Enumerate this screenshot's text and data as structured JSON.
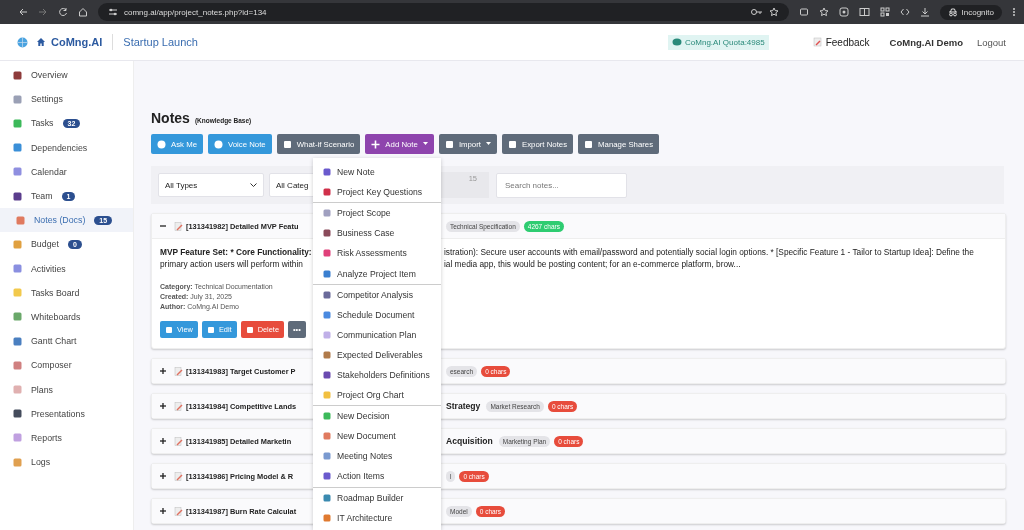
{
  "browser": {
    "url": "comng.ai/app/project_notes.php?id=134",
    "mode": "Incognito"
  },
  "header": {
    "brand": "CoMng.AI",
    "project": "Startup Launch",
    "quota": "CoMng.AI Quota:4985",
    "feedback": "Feedback",
    "user": "CoMng.AI Demo",
    "logout": "Logout"
  },
  "sidebar": {
    "items": [
      {
        "label": "Overview",
        "selected": false
      },
      {
        "label": "Settings",
        "selected": false
      },
      {
        "label": "Tasks",
        "badge": "32",
        "selected": false
      },
      {
        "label": "Dependencies",
        "selected": false
      },
      {
        "label": "Calendar",
        "selected": false
      },
      {
        "label": "Team",
        "badge": "1",
        "selected": false
      },
      {
        "label": "Notes (Docs)",
        "badge": "15",
        "selected": true
      },
      {
        "label": "Budget",
        "badge": "0",
        "selected": false
      },
      {
        "label": "Activities",
        "selected": false
      },
      {
        "label": "Tasks Board",
        "selected": false
      },
      {
        "label": "Whiteboards",
        "selected": false
      },
      {
        "label": "Gantt Chart",
        "selected": false
      },
      {
        "label": "Composer",
        "selected": false
      },
      {
        "label": "Plans",
        "selected": false
      },
      {
        "label": "Presentations",
        "selected": false
      },
      {
        "label": "Reports",
        "selected": false
      },
      {
        "label": "Logs",
        "selected": false
      }
    ]
  },
  "page": {
    "title": "Notes",
    "subtitle": "(Knowledge Base)"
  },
  "toolbar": [
    {
      "label": "Ask Me",
      "kind": "info",
      "dropdown": false
    },
    {
      "label": "Voice Note",
      "kind": "info",
      "dropdown": false
    },
    {
      "label": "What-if Scenario",
      "kind": "secondary",
      "dropdown": false
    },
    {
      "label": "Add Note",
      "kind": "primary",
      "dropdown": true
    },
    {
      "label": "Import",
      "kind": "secondary",
      "dropdown": true
    },
    {
      "label": "Export Notes",
      "kind": "secondary",
      "dropdown": false
    },
    {
      "label": "Manage Shares",
      "kind": "secondary",
      "dropdown": false
    }
  ],
  "filters": {
    "type": "All Types",
    "category": "All Categ",
    "count": "15",
    "search_placeholder": "Search notes..."
  },
  "add_note_menu": {
    "sections": [
      [
        "New Note",
        "Project Key Questions"
      ],
      [
        "Project Scope",
        "Business Case",
        "Risk Assessments",
        "Analyze Project Item"
      ],
      [
        "Competitor Analysis",
        "Schedule Document",
        "Communication Plan",
        "Expected Deliverables",
        "Stakeholders Definitions",
        "Project Org Chart"
      ],
      [
        "New Decision",
        "New Document",
        "Meeting Notes",
        "Action Items"
      ],
      [
        "Roadmap Builder",
        "IT Architecture"
      ]
    ]
  },
  "notes": [
    {
      "expanded": true,
      "title": "[131341982] Detailed MVP Featu",
      "tag": "Technical Specification",
      "chars": "4267 chars",
      "has_content": true,
      "body": [
        {
          "left": "MVP Feature Set: * Core Functionality:",
          "right": "istration): Secure user accounts with email/password and potentially social login options. * [Specific Feature 1 - Tailor to Startup Idea]: Define the"
        },
        {
          "left": "primary action users will perform within",
          "right": "ial media app, this would be posting content; for an e-commerce platform, brow..."
        }
      ],
      "meta": [
        {
          "label": "Category:",
          "value": "Technical Documentation"
        },
        {
          "label": "Created:",
          "value": "July 31, 2025"
        },
        {
          "label": "Author:",
          "value": "CoMng.AI Demo"
        }
      ],
      "actions": [
        {
          "label": "View",
          "kind": "info"
        },
        {
          "label": "Edit",
          "kind": "info"
        },
        {
          "label": "Delete",
          "kind": "danger"
        },
        {
          "label": "•••",
          "kind": "secondary"
        }
      ]
    },
    {
      "expanded": false,
      "title": "[131341983] Target Customer P",
      "tag": "esearch",
      "chars": "0 chars",
      "has_content": false
    },
    {
      "expanded": false,
      "title": "[131341984] Competitive Lands",
      "title_tail": "Strategy",
      "tag": "Market Research",
      "chars": "0 chars",
      "has_content": false
    },
    {
      "expanded": false,
      "title": "[131341985] Detailed Marketin",
      "title_tail": "Acquisition",
      "tag": "Marketing Plan",
      "chars": "0 chars",
      "has_content": false
    },
    {
      "expanded": false,
      "title": "[131341986] Pricing Model & R",
      "tag": "l",
      "chars": "0 chars",
      "has_content": false
    },
    {
      "expanded": false,
      "title": "[131341987] Burn Rate Calculat",
      "tag": "Model",
      "chars": "0 chars",
      "has_content": false
    }
  ]
}
